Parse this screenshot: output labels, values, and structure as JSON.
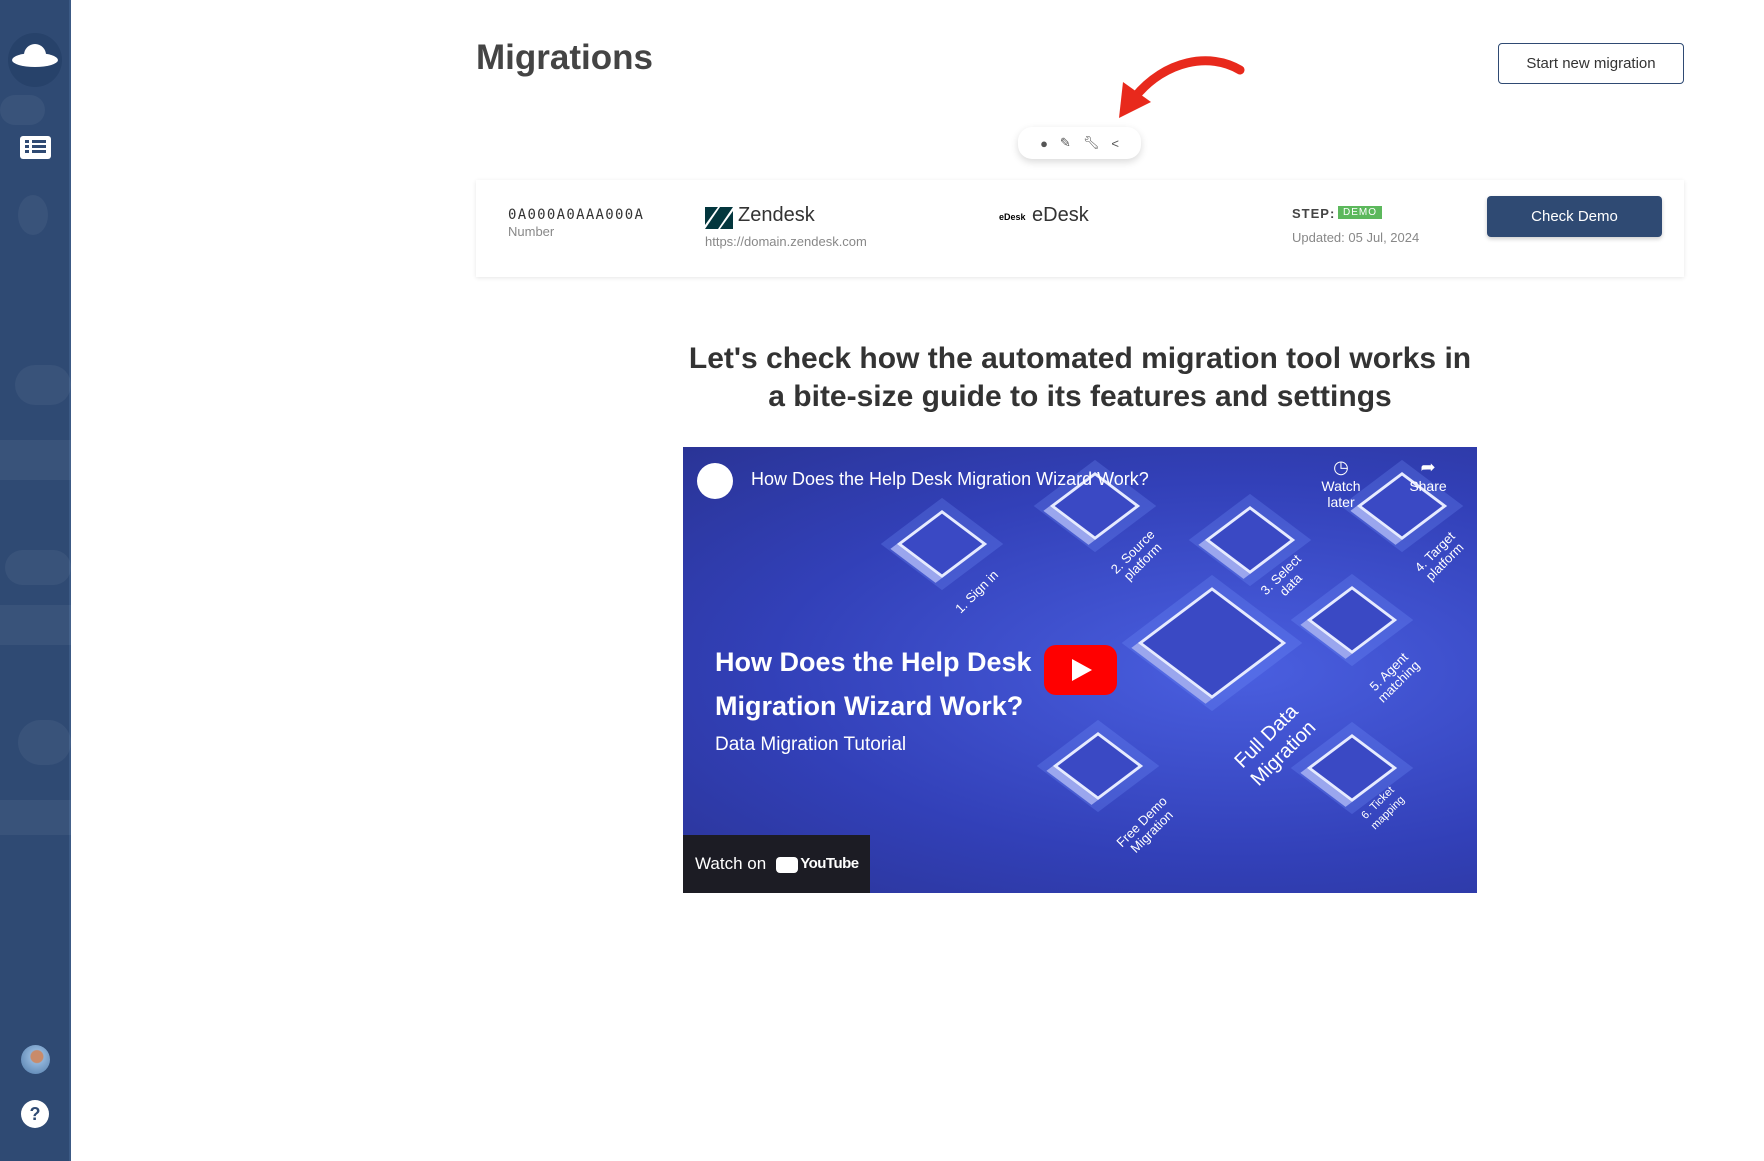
{
  "sidebar": {
    "items": [
      {
        "icon": "logo-icon"
      },
      {
        "icon": "list-icon"
      }
    ],
    "help_label": "?"
  },
  "header": {
    "title": "Migrations",
    "start_button": "Start new migration"
  },
  "toolbar": {
    "icons": [
      "info-icon",
      "edit-icon",
      "wrench-icon",
      "share-icon"
    ]
  },
  "migration": {
    "number": "0A000A0AAA000A",
    "number_label": "Number",
    "source": {
      "name": "Zendesk",
      "url": "https://domain.zendesk.com"
    },
    "target": {
      "logo_text": "eDesk",
      "name": "eDesk"
    },
    "step_label": "STEP:",
    "step_badge": "DEMO",
    "updated": "Updated: 05 Jul, 2024",
    "action": "Check Demo"
  },
  "guide": {
    "heading": "Let's check how the automated migration tool works in a bite-size guide to its features and settings"
  },
  "video": {
    "title": "How Does the Help Desk Migration Wizard Work?",
    "headline_line1": "How Does the Help Desk",
    "headline_line2": "Migration Wizard Work?",
    "subtitle": "Data Migration Tutorial",
    "watch_later": "Watch later",
    "share": "Share",
    "watch_on": "Watch on",
    "youtube": "YouTube",
    "steps": [
      "1. Sign in",
      "2. Source platform",
      "3. Select data",
      "4. Target platform",
      "5. Agent matching",
      "6. Ticket mapping",
      "Full Data Migration",
      "Free Demo Migration"
    ]
  },
  "colors": {
    "sidebar": "#2f4a73",
    "primary": "#2f4a73",
    "badge": "#5cb85c",
    "arrow": "#e8291c",
    "video_bg": "#3a49c4"
  }
}
